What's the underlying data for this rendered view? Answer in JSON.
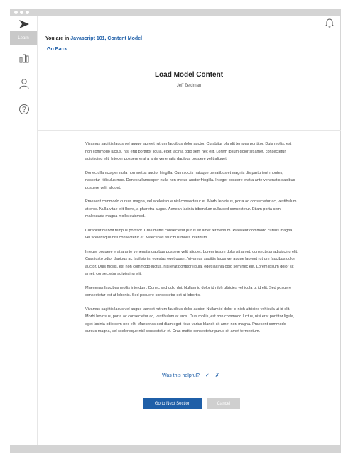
{
  "sidebar": {
    "learn_label": "Learn",
    "icons": [
      "analytics-icon",
      "user-icon",
      "help-icon"
    ]
  },
  "header": {
    "breadcrumb_prefix": "You are in",
    "breadcrumb_link": "Javascript 101, Content Model",
    "go_back": "Go Back"
  },
  "article": {
    "title": "Load Model Content",
    "author": "Jeff Zeldman",
    "paragraphs": [
      "Vivamus sagittis lacus vel augue laoreet rutrum faucibus dolor auctor. Curabitur blandit tempus porttitor. Duis mollis, est non commodo luctus, nisi erat porttitor ligula, eget lacinia odio sem nec elit. Lorem ipsum dolor sit amet, consectetur adipiscing elit. Integer posuere erat a ante venenatis dapibus posuere velit aliquet.",
      "Donec ullamcorper nulla non metus auctor fringilla. Cum sociis natoque penatibus et magnis dis parturient montes, nascetur ridiculus mus. Donec ullamcorper nulla non metus auctor fringilla. Integer posuere erat a ante venenatis dapibus posuere velit aliquet.",
      "Praesent commodo cursus magna, vel scelerisque nisl consectetur et. Morbi leo risus, porta ac consectetur ac, vestibulum at eros. Nulla vitae elit libero, a pharetra augue. Aenean lacinia bibendum nulla sed consectetur. Etiam porta sem malesuada magna mollis euismod.",
      "Curabitur blandit tempus porttitor. Cras mattis consectetur purus sit amet fermentum. Praesent commodo cursus magna, vel scelerisque nisl consectetur et. Maecenas faucibus mollis interdum.",
      "Integer posuere erat a ante venenatis dapibus posuere velit aliquet. Lorem ipsum dolor sit amet, consectetur adipiscing elit. Cras justo odio, dapibus ac facilisis in, egestas eget quam. Vivamus sagittis lacus vel augue laoreet rutrum faucibus dolor auctor. Duis mollis, est non commodo luctus, nisi erat porttitor ligula, eget lacinia odio sem nec elit. Lorem ipsum dolor sit amet, consectetur adipiscing elit.",
      "Maecenas faucibus mollis interdum. Donec sed odio dui. Nullam id dolor id nibh ultricies vehicula ut id elit. Sed posuere consectetur est at lobortis. Sed posuere consectetur est at lobortis.",
      "Vivamus sagittis lacus vel augue laoreet rutrum faucibus dolor auctor. Nullam id dolor id nibh ultricies vehicula ut id elit. Morbi leo risus, porta ac consectetur ac, vestibulum at eros. Duis mollis, est non commodo luctus, nisi erat porttitor ligula, eget lacinia odio sem nec elit. Maecenas sed diam eget risus varius blandit sit amet non magna. Praesent commodo cursus magna, vel scelerisque nisl consectetur et. Cras mattis consectetur purus sit amet fermentum."
    ]
  },
  "feedback": {
    "question": "Was this helpful?",
    "yes_mark": "✓",
    "no_mark": "✗"
  },
  "actions": {
    "next_label": "Go to Next Section",
    "cancel_label": "Cancel"
  },
  "colors": {
    "accent": "#1f5fa8",
    "chrome": "#d4d4d4",
    "cancel": "#cfcfcf"
  }
}
